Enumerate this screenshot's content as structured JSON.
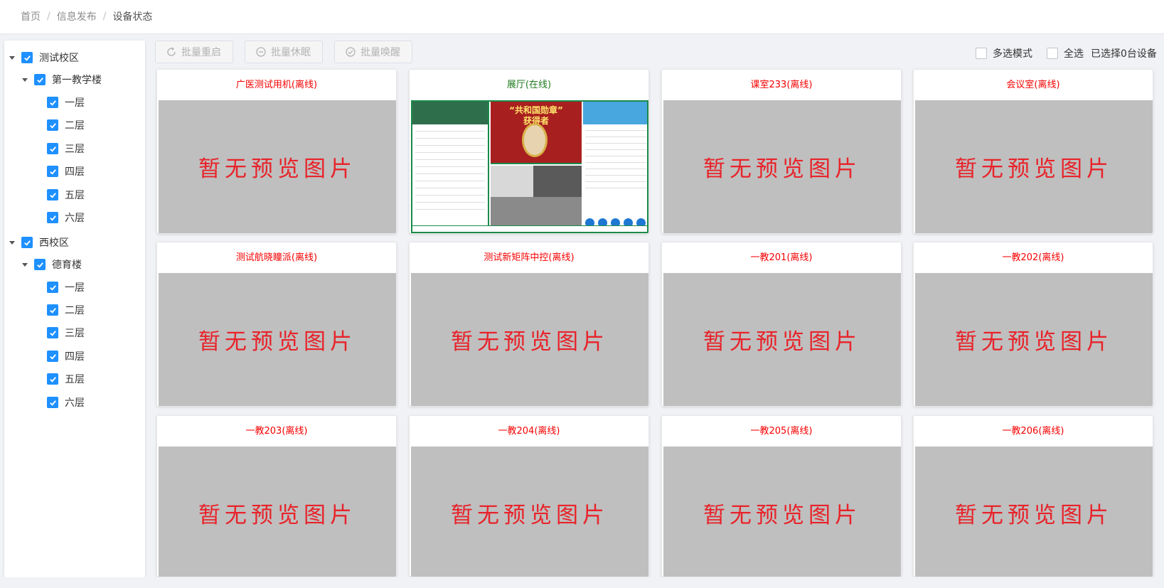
{
  "breadcrumb": {
    "home": "首页",
    "section": "信息发布",
    "current": "设备状态"
  },
  "toolbar": {
    "reboot_label": "批量重启",
    "sleep_label": "批量休眠",
    "wake_label": "批量唤醒",
    "multi_select_label": "多选模式",
    "select_all_label": "全选",
    "selected_count_text": "已选择0台设备"
  },
  "tree": {
    "campus1": {
      "label": "测试校区",
      "building": {
        "label": "第一教学楼",
        "floors": [
          "一层",
          "二层",
          "三层",
          "四层",
          "五层",
          "六层"
        ]
      }
    },
    "campus2": {
      "label": "西校区",
      "building": {
        "label": "德育楼",
        "floors": [
          "一层",
          "二层",
          "三层",
          "四层",
          "五层",
          "六层"
        ]
      }
    }
  },
  "no_preview_text": "暂无预览图片",
  "devices": [
    {
      "name": "广医测试用机(离线)",
      "status": "offline"
    },
    {
      "name": "展厅(在线)",
      "status": "online"
    },
    {
      "name": "课室233(离线)",
      "status": "offline"
    },
    {
      "name": "会议室(离线)",
      "status": "offline"
    },
    {
      "name": "测试航晓瞳派(离线)",
      "status": "offline"
    },
    {
      "name": "测试新矩阵中控(离线)",
      "status": "offline"
    },
    {
      "name": "一教201(离线)",
      "status": "offline"
    },
    {
      "name": "一教202(离线)",
      "status": "offline"
    },
    {
      "name": "一教203(离线)",
      "status": "offline"
    },
    {
      "name": "一教204(离线)",
      "status": "offline"
    },
    {
      "name": "一教205(离线)",
      "status": "offline"
    },
    {
      "name": "一教206(离线)",
      "status": "offline"
    }
  ],
  "online_preview": {
    "slogan_line1": "“共和国勋章”",
    "slogan_line2": "获得者"
  },
  "colors": {
    "offline": "#f50000",
    "online": "#1f7a1f",
    "accent": "#1e90ff"
  }
}
